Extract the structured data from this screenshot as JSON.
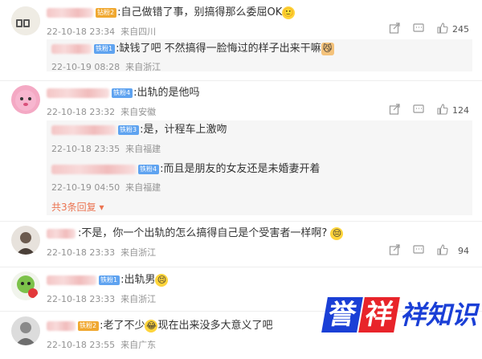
{
  "comments": [
    {
      "badge": "钻粉2",
      "text": ":自己做错了事，别搞得那么委屈OK",
      "emoji": "🙂",
      "time": "22-10-18 23:34",
      "location": "来自四川",
      "likes": "245",
      "replies": [
        {
          "badge": "铁粉1",
          "text": ":缺钱了吧 不然搞得一脸悔过的样子出来干嘛",
          "time": "22-10-19 08:28",
          "location": "来自浙江"
        }
      ]
    },
    {
      "badge": "铁粉4",
      "text": ":出轨的是他吗",
      "time": "22-10-18 23:32",
      "location": "来自安徽",
      "likes": "124",
      "replies": [
        {
          "badge": "铁粉3",
          "text": ":是，计程车上激吻",
          "time": "22-10-18 23:35",
          "location": "来自福建"
        },
        {
          "badge": "铁粉4",
          "text": ":而且是朋友的女友还是未婚妻开着",
          "time": "22-10-19 04:50",
          "location": "来自福建"
        }
      ],
      "more_replies": "共3条回复"
    },
    {
      "text": ":不是，你一个出轨的怎么搞得自己是个受害者一样啊?",
      "time": "22-10-18 23:33",
      "location": "来自浙江",
      "likes": "94"
    },
    {
      "badge": "铁粉1",
      "text": ":出轨男",
      "time": "22-10-18 23:33",
      "location": "来自浙江"
    },
    {
      "badge": "铁粉2",
      "text_before": ":老了不少",
      "text_after": "现在出来没多大意义了吧",
      "time": "22-10-18 23:55",
      "location": "来自广东"
    }
  ],
  "watermark": {
    "char1": "誉",
    "char2": "祥",
    "rest": "祥知识"
  },
  "colors": {
    "accent": "#eb7350",
    "watermark_blue": "#1a3fd6",
    "watermark_red": "#e8242a"
  }
}
